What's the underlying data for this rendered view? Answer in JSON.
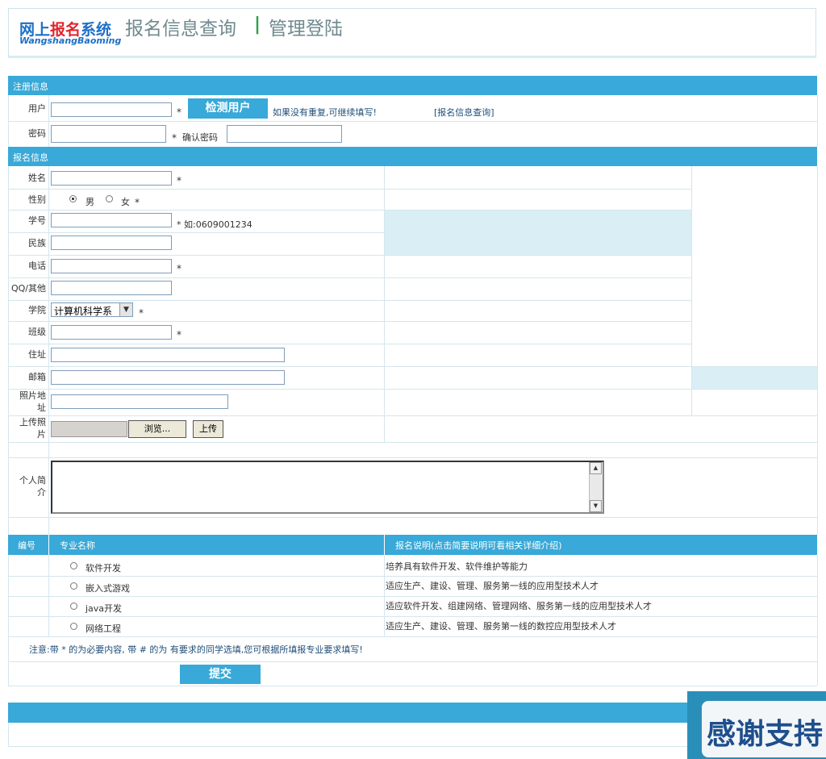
{
  "header": {
    "logo_cn_a": "网上",
    "logo_cn_b": "报名",
    "logo_cn_c": "系统",
    "logo_en": "WangshangBaoming",
    "nav_query": "报名信息查询",
    "nav_sep": "|",
    "nav_admin": "管理登陆"
  },
  "register": {
    "section_title": "注册信息",
    "user_label": "用户",
    "check_user_button": "检测用户",
    "hint": "如果没有重复,可继续填写!",
    "query_link": "[报名信息查询]",
    "password_label": "密码",
    "confirm_label": "确认密码",
    "required_mark": "*"
  },
  "signup": {
    "section_title": "报名信息",
    "name_label": "姓名",
    "gender_label": "性别",
    "gender_male": "男",
    "gender_female": "女",
    "gender_selected": "男",
    "student_id_label": "学号",
    "student_id_hint": "* 如:0609001234",
    "ethnicity_label": "民族",
    "phone_label": "电话",
    "qq_label": "QQ/其他",
    "college_label": "学院",
    "college_value": "计算机科学系",
    "class_label": "班级",
    "address_label": "住址",
    "email_label": "邮箱",
    "photo_url_label": "照片地址",
    "upload_photo_label": "上传照片",
    "browse_button": "浏览...",
    "upload_button": "上传",
    "intro_label": "个人简介",
    "required_mark": "*"
  },
  "majors": {
    "col_no": "编号",
    "col_name": "专业名称",
    "col_desc": "报名说明(点击简要说明可看相关详细介绍)",
    "rows": [
      {
        "name": "软件开发",
        "desc": "培养具有软件开发、软件维护等能力"
      },
      {
        "name": "嵌入式游戏",
        "desc": "适应生产、建设、管理、服务第一线的应用型技术人才"
      },
      {
        "name": "java开发",
        "desc": "适应软件开发、组建网络、管理网络、服务第一线的应用型技术人才"
      },
      {
        "name": "网络工程",
        "desc": "适应生产、建设、管理、服务第一线的数控应用型技术人才"
      }
    ]
  },
  "note": "注意:带 * 的为必要内容, 带 # 的为 有要求的同学选填,您可根据所填报专业要求填写!",
  "submit_button": "提交",
  "banner_text": "感谢支持",
  "colors": {
    "bar_blue": "#38a9d8",
    "light_fill": "#daeef6",
    "logo_blue": "#1d6fc6",
    "logo_red": "#e0242c",
    "nav_green": "#2fa24a"
  }
}
